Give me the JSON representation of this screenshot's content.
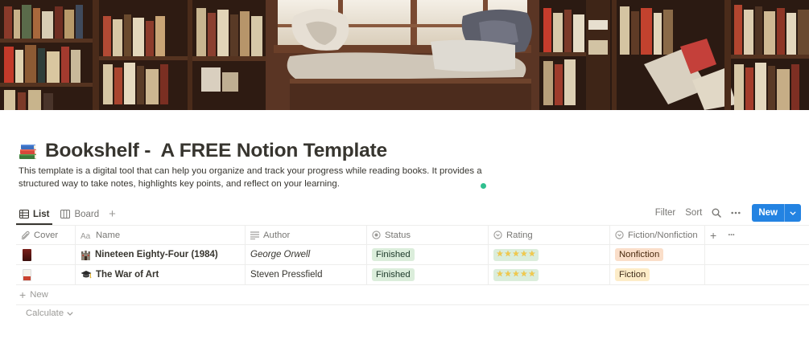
{
  "page": {
    "icon": "books-emoji-icon",
    "title": "Bookshelf -  A FREE Notion Template",
    "description": "This template is a digital tool that can help you organize and track your progress while reading books. It provides a structured way to take notes, highlights key points, and reflect on your learning."
  },
  "views": {
    "tabs": [
      {
        "label": "List",
        "icon": "list-icon",
        "active": true
      },
      {
        "label": "Board",
        "icon": "board-icon",
        "active": false
      }
    ],
    "add_view": "+"
  },
  "toolbar": {
    "filter": "Filter",
    "sort": "Sort",
    "search_icon": "search-icon",
    "more_icon": "ellipsis-icon",
    "new_label": "New",
    "new_chevron": "chevron-down-icon"
  },
  "table": {
    "columns": [
      {
        "label": "Cover",
        "icon": "paperclip-icon"
      },
      {
        "label": "Name",
        "icon": "aa-text-icon"
      },
      {
        "label": "Author",
        "icon": "lines-icon"
      },
      {
        "label": "Status",
        "icon": "status-circle-icon"
      },
      {
        "label": "Rating",
        "icon": "select-circle-icon"
      },
      {
        "label": "Fiction/Nonfiction",
        "icon": "select-circle-icon"
      }
    ],
    "add_column": "+",
    "more_column": "···",
    "rows": [
      {
        "cover": "book-cover-red",
        "emoji": "castle-icon",
        "name": "Nineteen Eighty-Four (1984)",
        "author": "George Orwell",
        "author_italic": true,
        "status": "Finished",
        "rating": 5,
        "genre": "Nonfiction",
        "genre_color": "orange"
      },
      {
        "cover": "book-cover-white",
        "emoji": "graduation-cap-icon",
        "name": "The War of Art",
        "author": "Steven Pressfield",
        "author_italic": false,
        "status": "Finished",
        "rating": 5,
        "genre": "Fiction",
        "genre_color": "yellow"
      }
    ],
    "new_row_label": "New",
    "calculate_label": "Calculate"
  },
  "colors": {
    "accent": "#2383e2",
    "status_green": "#dbeddb",
    "nonfiction_orange": "#fadec9",
    "fiction_yellow": "#fdecc8",
    "star": "#f2c94c"
  }
}
